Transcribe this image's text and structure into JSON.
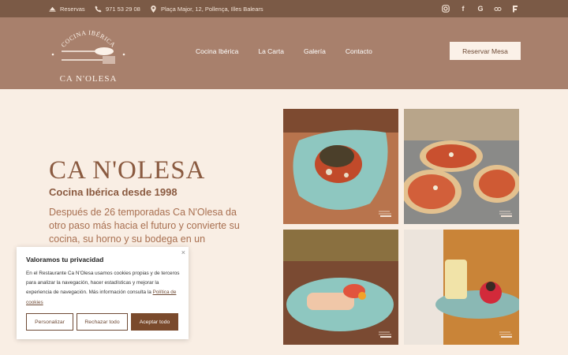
{
  "topbar": {
    "reservas": "Reservas",
    "phone": "971 53 29 08",
    "address": "Plaça Major, 12, Pollença, Illes Balears",
    "social_icons": [
      "instagram-icon",
      "facebook-icon",
      "google-icon",
      "tripadvisor-icon",
      "thefork-icon"
    ]
  },
  "logo": {
    "arc_text": "COCINA IBÉRICA",
    "name": "CA N'OLESA"
  },
  "nav": {
    "links": [
      "Cocina Ibérica",
      "La Carta",
      "Galería",
      "Contacto"
    ],
    "cta": "Reservar Mesa"
  },
  "hero": {
    "title": "CA N'OLESA",
    "subtitle": "Cocina Ibérica desde 1998",
    "description": "Después de 26 temporadas Ca N'Olesa da otro paso más hacia el futuro y convierte su cocina, su horno y su bodega en un"
  },
  "gallery": [
    {
      "name": "plate-vegetables-photo"
    },
    {
      "name": "pizzas-photo"
    },
    {
      "name": "fish-dish-photo"
    },
    {
      "name": "dessert-photo"
    }
  ],
  "cookie": {
    "title": "Valoramos tu privacidad",
    "text": "En el Restaurante Ca N'Olesa usamos cookies propias y de terceros para analizar la navegación, hacer estadísticas y mejorar la experiencia de navegación. Más información consulta la",
    "policy_link": "Política de cookies",
    "close": "×",
    "btn_customize": "Personalizar",
    "btn_reject": "Rechazar todo",
    "btn_accept": "Aceptar todo"
  },
  "colors": {
    "topbar": "#7b5a46",
    "navbar": "#a8806c",
    "background": "#f9eee4",
    "accent": "#8a5a40",
    "accept_button": "#7a4a2c"
  }
}
